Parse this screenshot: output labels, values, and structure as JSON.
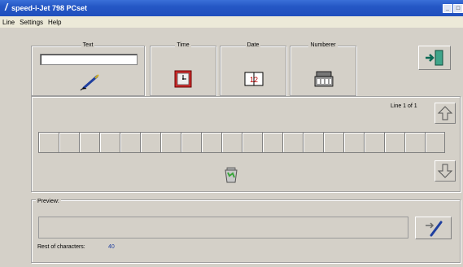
{
  "window": {
    "title": "speed-i-Jet 798 PCset"
  },
  "menu": {
    "items": [
      "Line",
      "Settings",
      "Help"
    ]
  },
  "insert": {
    "text_label": "Text",
    "text_value": "",
    "time_label": "Time",
    "date_label": "Date",
    "date_icon_text": "12",
    "numberer_label": "Numberer"
  },
  "lines": {
    "indicator": "Line 1 of 1",
    "cell_count": 20
  },
  "preview": {
    "label": "Preview:",
    "value": "",
    "rest_label": "Rest of characters:",
    "rest_value": "40"
  },
  "colors": {
    "title_bar": "#2557c5",
    "face": "#d4d0c8",
    "accent_blue": "#1f3f9f",
    "time_red": "#d02a2a"
  }
}
